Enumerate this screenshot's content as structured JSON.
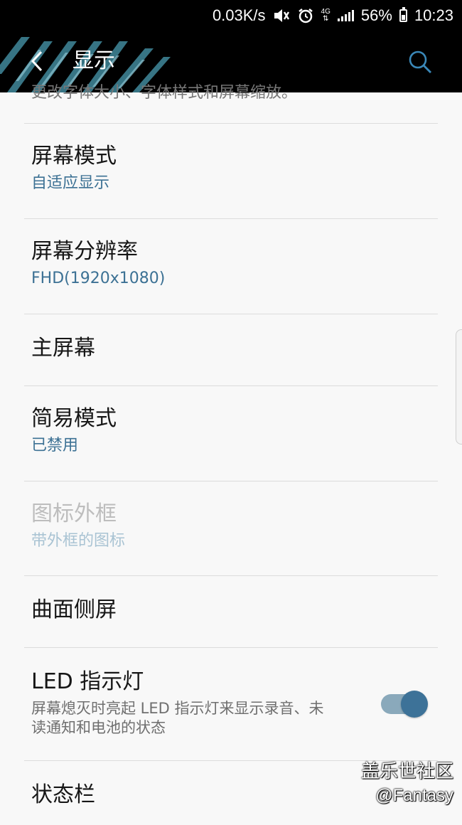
{
  "status_bar": {
    "net_speed": "0.03K/s",
    "network_type": "4G",
    "battery": "56%",
    "battery_level": 0.56,
    "time": "10:23",
    "icons": [
      "mute-icon",
      "alarm-icon",
      "signal-icon",
      "battery-icon"
    ]
  },
  "app_bar": {
    "title": "显示",
    "back_icon": "chevron-left-icon",
    "search_icon": "search-icon"
  },
  "list": {
    "clipped_text": "更改字体大小、字体样式和屏幕缩放。",
    "items": [
      {
        "title": "屏幕模式",
        "subtitle": "自适应显示"
      },
      {
        "title": "屏幕分辨率",
        "subtitle": "FHD(1920x1080)"
      },
      {
        "title": "主屏幕"
      },
      {
        "title": "简易模式",
        "subtitle": "已禁用"
      },
      {
        "title": "图标外框",
        "subtitle": "带外框的图标",
        "disabled": true
      },
      {
        "title": "曲面侧屏"
      },
      {
        "title": "LED 指示灯",
        "description": "屏幕熄灭时亮起 LED 指示灯来显示录音、未读通知和电池的状态",
        "toggle_on": true
      },
      {
        "title": "状态栏"
      }
    ]
  },
  "watermark": {
    "line1": "盖乐世社区",
    "line2": "@Fantasy"
  },
  "colors": {
    "accent": "#3c7194",
    "toggle_knob": "#3d7298",
    "toggle_track": "#8aa9bb",
    "background": "#f8f8f8",
    "appbar": "#000000"
  }
}
